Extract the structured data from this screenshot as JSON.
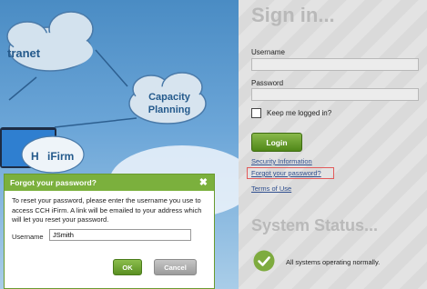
{
  "background": {
    "clouds": [
      "tranet",
      "Capacity",
      "Planning",
      "H",
      "iFirm"
    ]
  },
  "signin": {
    "title": "Sign in...",
    "username_label": "Username",
    "username_value": "",
    "password_label": "Password",
    "password_value": "",
    "keep_logged_in_label": "Keep me logged in?",
    "keep_logged_in_checked": false,
    "login_button": "Login",
    "links": {
      "security": "Security Information",
      "forgot": "Forgot your password?",
      "terms": "Terms of Use"
    }
  },
  "status": {
    "title": "System Status...",
    "message": "All systems operating normally.",
    "icon": "checkmark-icon"
  },
  "dialog": {
    "title": "Forgot your password?",
    "message": "To reset your password, please enter the username you use to access CCH iFirm. A link will be emailed to your address which will let you reset your password.",
    "username_label": "Username",
    "username_value": "JSmith",
    "ok_button": "OK",
    "cancel_button": "Cancel"
  },
  "colors": {
    "accent_green": "#7bb03d",
    "highlight_red": "#e25b5b",
    "link_blue": "#2f4f8f"
  }
}
